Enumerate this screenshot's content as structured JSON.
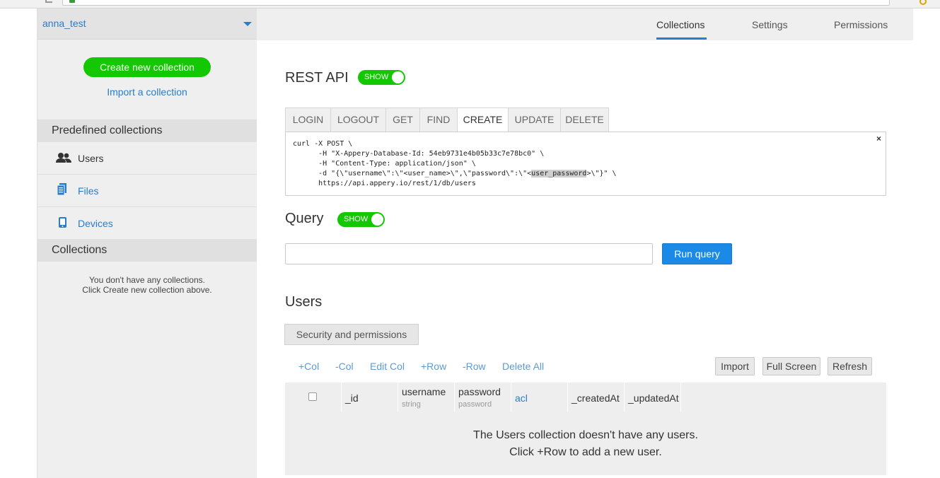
{
  "sidebar": {
    "database_name": "anna_test",
    "create_button": "Create new collection",
    "import_link": "Import a collection",
    "predefined_heading": "Predefined collections",
    "predefined_items": [
      {
        "label": "Users",
        "icon": "users-icon"
      },
      {
        "label": "Files",
        "icon": "files-icon"
      },
      {
        "label": "Devices",
        "icon": "devices-icon"
      }
    ],
    "collections_heading": "Collections",
    "empty_line1": "You don't have any collections.",
    "empty_line2": "Click Create new collection above."
  },
  "topnav": {
    "tabs": [
      "Collections",
      "Settings",
      "Permissions"
    ],
    "active": "Collections"
  },
  "rest_api": {
    "title": "REST API",
    "toggle_label": "SHOW",
    "tabs": [
      "LOGIN",
      "LOGOUT",
      "GET",
      "FIND",
      "CREATE",
      "UPDATE",
      "DELETE"
    ],
    "active_tab": "CREATE",
    "code_lines": [
      "curl -X POST \\",
      "      -H \"X-Appery-Database-Id: 54eb9731e4b05b33c7e78bc0\" \\",
      "      -H \"Content-Type: application/json\" \\",
      "      -d \"{\\\"username\\\":\\\"<user_name>\\\",\\\"password\\\":\\\"<",
      "user_password",
      ">\\\"}\" \\",
      "      https://api.appery.io/rest/1/db/users"
    ],
    "close_glyph": "×"
  },
  "query": {
    "title": "Query",
    "toggle_label": "SHOW",
    "input_value": "",
    "run_button": "Run query"
  },
  "users": {
    "title": "Users",
    "security_button": "Security and permissions",
    "actions": [
      "+Col",
      "-Col",
      "Edit Col",
      "+Row",
      "-Row",
      "Delete All"
    ],
    "tool_buttons": [
      "Import",
      "Full Screen",
      "Refresh"
    ],
    "columns": [
      {
        "name": "_id",
        "type": ""
      },
      {
        "name": "username",
        "type": "string"
      },
      {
        "name": "password",
        "type": "password"
      },
      {
        "name": "acl",
        "type": ""
      },
      {
        "name": "_createdAt",
        "type": ""
      },
      {
        "name": "_updatedAt",
        "type": ""
      }
    ],
    "empty_line1": "The Users collection doesn't have any users.",
    "empty_line2": "Click +Row to add a new user."
  },
  "colors": {
    "accent_blue": "#2b7ccb",
    "green": "#13c800",
    "run_blue": "#1a8ae6"
  }
}
